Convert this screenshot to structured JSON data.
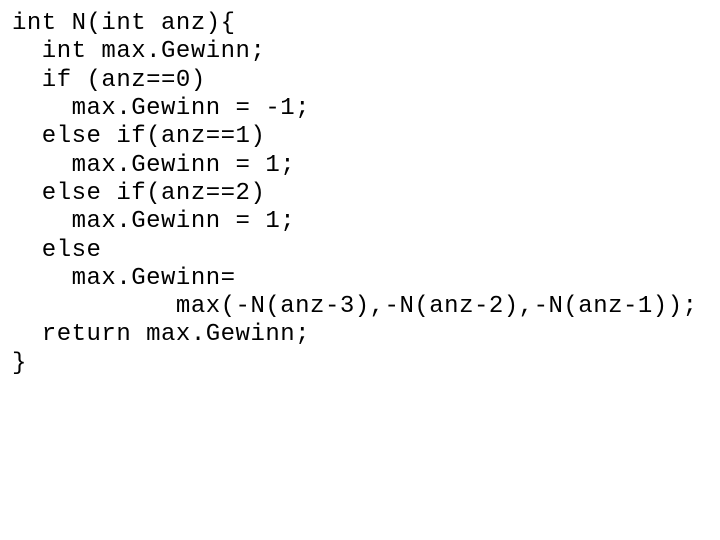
{
  "code": {
    "lines": [
      "int N(int anz){",
      "  int max.Gewinn;",
      "  if (anz==0)",
      "    max.Gewinn = -1;",
      "  else if(anz==1)",
      "    max.Gewinn = 1;",
      "  else if(anz==2)",
      "    max.Gewinn = 1;",
      "  else",
      "    max.Gewinn=",
      "           max(-N(anz-3),-N(anz-2),-N(anz-1));",
      "  return max.Gewinn;",
      "}"
    ]
  }
}
